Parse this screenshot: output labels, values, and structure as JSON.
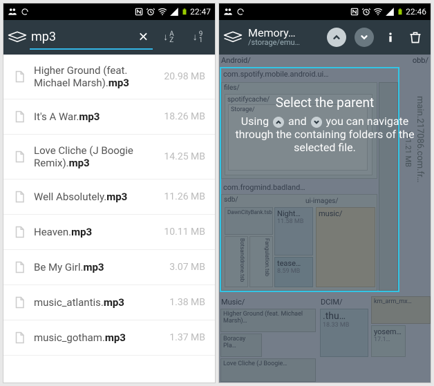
{
  "left": {
    "status": {
      "time": "22:47",
      "icons": [
        "contacts",
        "alarm",
        "wifi",
        "signal",
        "battery"
      ]
    },
    "search": {
      "value": "mp3"
    },
    "sort": {
      "alpha": "AZ",
      "num": "91"
    },
    "files": [
      {
        "name_pre": "Higher Ground (feat. Michael Marsh).",
        "name_bold": "mp3",
        "size": "20.98 MB"
      },
      {
        "name_pre": "It's A War.",
        "name_bold": "mp3",
        "size": "18.26 MB"
      },
      {
        "name_pre": "Love Cliche (J Boogie Remix).",
        "name_bold": "mp3",
        "size": "14.25 MB"
      },
      {
        "name_pre": "Well Absolutely.",
        "name_bold": "mp3",
        "size": "11.26 MB"
      },
      {
        "name_pre": "Heaven.",
        "name_bold": "mp3",
        "size": "10.11 MB"
      },
      {
        "name_pre": "Be My Girl.",
        "name_bold": "mp3",
        "size": "3.07 MB"
      },
      {
        "name_pre": "music_atlantis.",
        "name_bold": "mp3",
        "size": "1.38 MB"
      },
      {
        "name_pre": "music_gotham.",
        "name_bold": "mp3",
        "size": "1.37 MB"
      }
    ]
  },
  "right": {
    "status": {
      "time": "22:46",
      "icons": [
        "contacts",
        "alarm",
        "wifi",
        "signal",
        "battery"
      ]
    },
    "path": {
      "title": "Memory…",
      "sub": "/storage/emu…"
    },
    "tooltip": {
      "title": "Select the parent",
      "body_pre": "Using ",
      "body_mid": " and ",
      "body_post": " you can navigate through the containing folders of the selected file."
    },
    "treemap": {
      "top_row": [
        "Android/",
        "obb/"
      ],
      "sel_top": "com.spotify.mobile.android.ui…",
      "sel_sub1": "files/",
      "sel_sub2": "spotifycache/",
      "sel_sub3": "Storage/",
      "sel2": "com.frogmind.badland…",
      "sel2_sub": "sdb/",
      "sel2_ui": "ui-images/",
      "sel2_items": [
        "DawnCityBank.tsb",
        "Botsanddrone.tsb",
        "Fangulation.tsb",
        "Night…",
        "tease…"
      ],
      "sel2_vals": [
        "11.58 MB",
        "8.59 MB"
      ],
      "sel2_music": "music/",
      "side_label": "main.217086.com.fr…",
      "side_size": "141.21 MB",
      "bottom": {
        "music": "Music/",
        "music_items": [
          "Higher Ground (feat. Michael Marsh)…",
          "Boracay Pla…",
          "Love Cliche (J Boogie…"
        ],
        "dcim": "DCIM/",
        "thu": ".thu…",
        "thu_size": "18.33 MB",
        "rest": [
          "km_arm_mx…",
          "yosem…",
          "17.1…"
        ]
      }
    }
  }
}
